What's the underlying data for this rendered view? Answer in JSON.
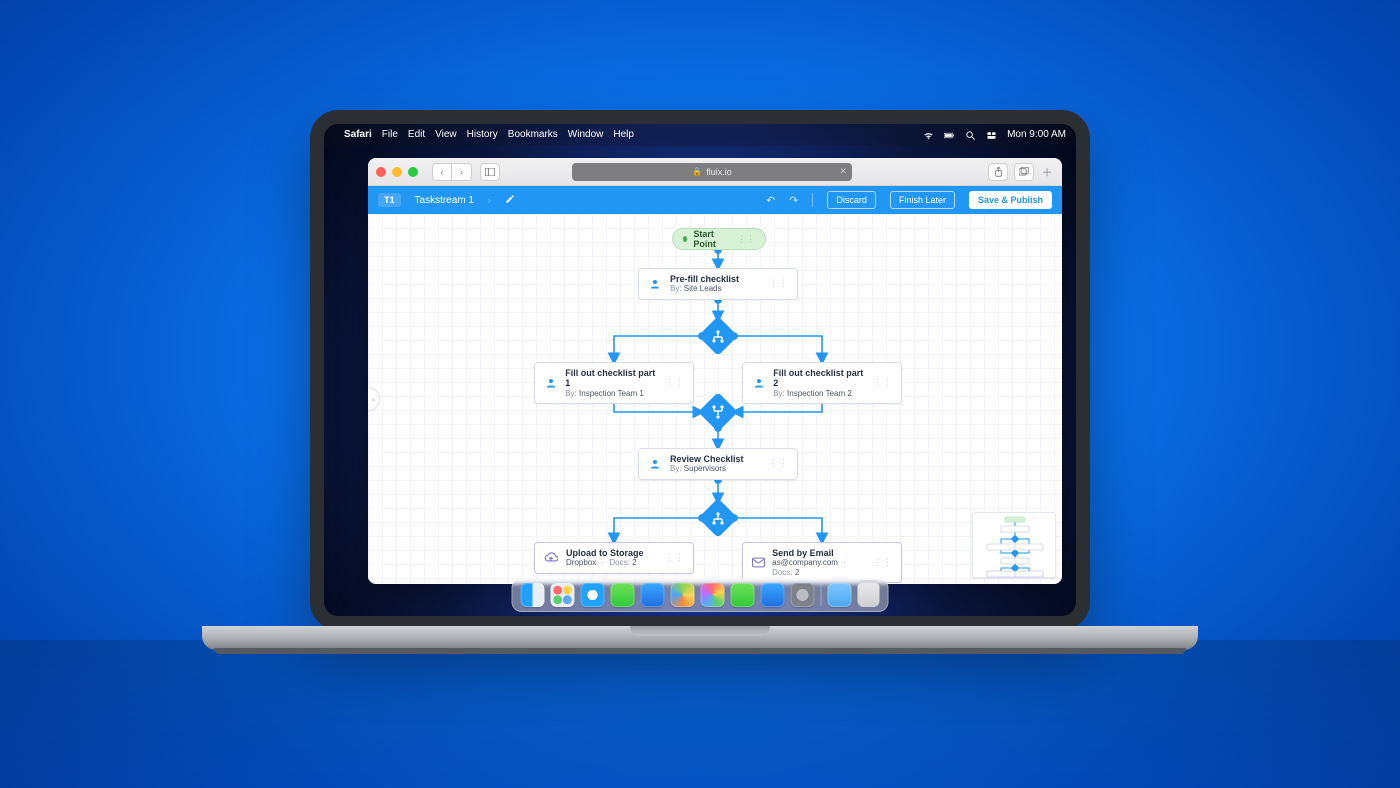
{
  "menubar": {
    "app": "Safari",
    "items": [
      "File",
      "Edit",
      "View",
      "History",
      "Bookmarks",
      "Window",
      "Help"
    ],
    "clock": "Mon 9:00 AM"
  },
  "browser": {
    "url_host": "fluix.io"
  },
  "app_header": {
    "crumb": "T1",
    "title": "Taskstream 1",
    "discard": "Discard",
    "finish_later": "Finish Later",
    "save_publish": "Save & Publish"
  },
  "flow": {
    "start": {
      "label": "Start Point"
    },
    "nodes": {
      "prefill": {
        "title": "Pre-fill checklist",
        "by_prefix": "By:",
        "by": "Site Leads"
      },
      "part1": {
        "title": "Fill out checklist part 1",
        "by_prefix": "By:",
        "by": "Inspection Team 1"
      },
      "part2": {
        "title": "Fill out checklist part 2",
        "by_prefix": "By:",
        "by": "Inspection Team 2"
      },
      "review": {
        "title": "Review Checklist",
        "by_prefix": "By:",
        "by": "Supervisors"
      },
      "upload": {
        "title": "Upload to Storage",
        "sub_label": "Dropbox",
        "docs_label": "Docs:",
        "docs_count": "2"
      },
      "email": {
        "title": "Send by Email",
        "sub_label": "as@company.com",
        "docs_label": "Docs:",
        "docs_count": "2"
      }
    }
  }
}
